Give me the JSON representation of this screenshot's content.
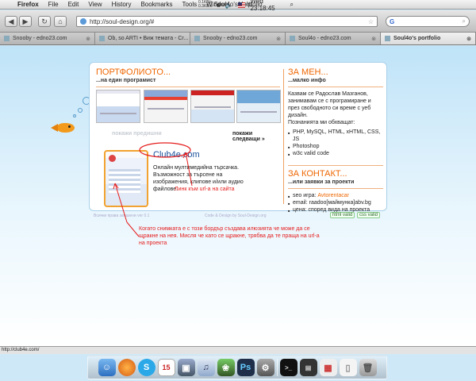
{
  "menubar": {
    "app": "Firefox",
    "items": [
      "File",
      "Edit",
      "View",
      "History",
      "Bookmarks",
      "Tools",
      "Window",
      "Help"
    ],
    "window_title": "Soul4o's portfolio",
    "net_up": "0.1KB/s",
    "net_down": "0.3KB/s",
    "clock": "Wed 23:18:45"
  },
  "toolbar": {
    "url": "http://soul-design.org/#",
    "search_engine": "G"
  },
  "tabs": [
    {
      "label": "Snooby - edno23.com",
      "active": false
    },
    {
      "label": "Ob, so ARTI • Виж темата - Cr...",
      "active": false
    },
    {
      "label": "Snooby - edno23.com",
      "active": false
    },
    {
      "label": "Soul4o - edno23.com",
      "active": false
    },
    {
      "label": "Soul4o's portfolio",
      "active": true
    }
  ],
  "portfolio": {
    "title": "ПОРТФОЛИОТО...",
    "subtitle": "...на един програмист",
    "prev_label": "покажи предишни",
    "next_label": "покажи следващи »",
    "project_title": "Club4e.com",
    "project_desc": "Онлайн мултимедийна търсачка. Възможност за търсене на изображения, клипове и/или аудио файлове."
  },
  "about": {
    "title": "ЗА МЕН...",
    "subtitle": "...малко инфо",
    "text": "Казвам се Радослав Мазганов, занимавам се с програмиране и през свободното си време с уеб дизайн.",
    "skills_intro": "Познанията ми обхващат:",
    "skills": [
      "PHP, MySQL, HTML, xHTML, CSS, JS",
      "Photoshop",
      "w3c valid code"
    ]
  },
  "contact": {
    "title": "ЗА КОНТАКТ...",
    "subtitle": "...или заявки за проекти",
    "seo_label": "seo игра:",
    "seo_value": "Avtorentacar",
    "email": "email: raadoo[маймунка]abv.bg",
    "price": "цена: според вида на проекта"
  },
  "footer": {
    "copyright": "Всички права запазени ver 0.1",
    "credits": "Code & Design by Soul-Design.org",
    "html_valid": "html valid",
    "css_valid": "css valid"
  },
  "annotations": {
    "link_note": "Линк към url-а на сайта",
    "border_note": "Когато снимката е с този бордър създава илюзията че може да се щракне на нея. Мисля че като се щракне, трябва да те праща на url-а на проекта"
  },
  "statusbar": {
    "text": "http://club4e.com/"
  },
  "dock": {
    "calendar_day": "15",
    "skype_badge": "3"
  },
  "colors": {
    "accent": "#ee6600",
    "annotation": "#e51c1c",
    "featured_border": "#f2a230"
  }
}
